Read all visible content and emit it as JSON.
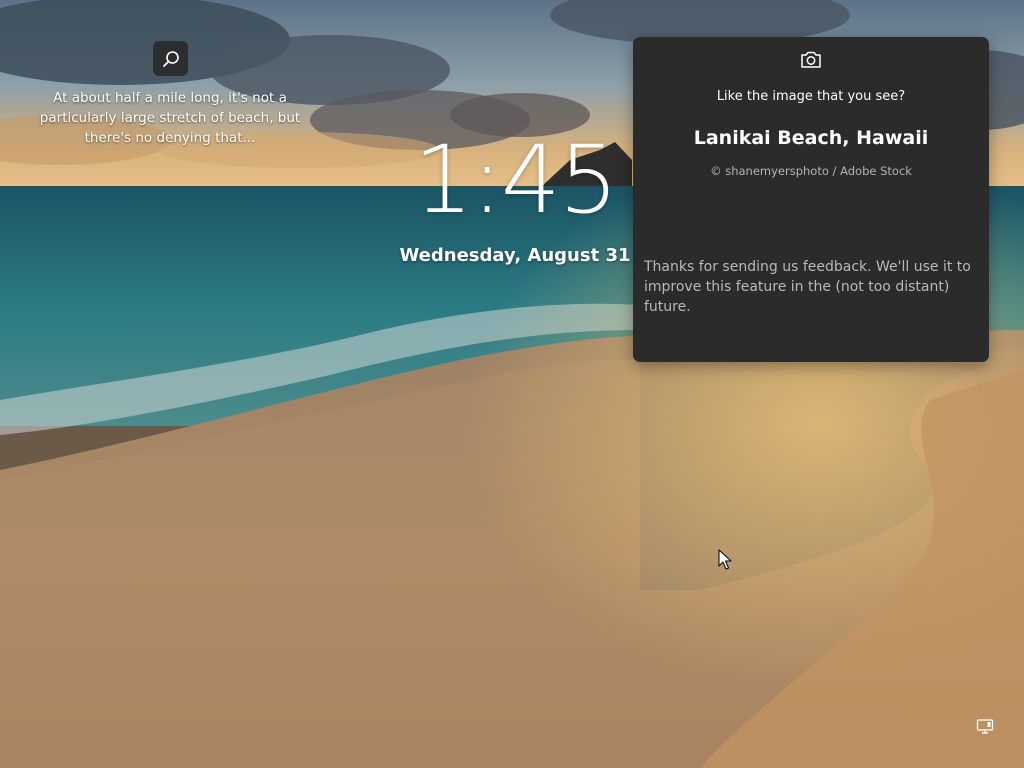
{
  "lockscreen": {
    "search_icon": "search-icon",
    "blurb": "At about half a mile long, it's not a particularly large stretch of beach, but there's no denying that...",
    "time": "1:45",
    "date": "Wednesday, August 31"
  },
  "info_card": {
    "icon": "camera-icon",
    "question": "Like the image that you see?",
    "title": "Lanikai Beach, Hawaii",
    "credit": "© shanemyersphoto / Adobe Stock",
    "feedback": "Thanks for sending us feedback. We'll use it to improve this feature in the (not too distant) future."
  },
  "system_tray": {
    "network_icon": "network-icon"
  },
  "colors": {
    "card_background": "#2b2b2b",
    "sea": "#1f5f6e",
    "sand": "#b58a5d"
  }
}
